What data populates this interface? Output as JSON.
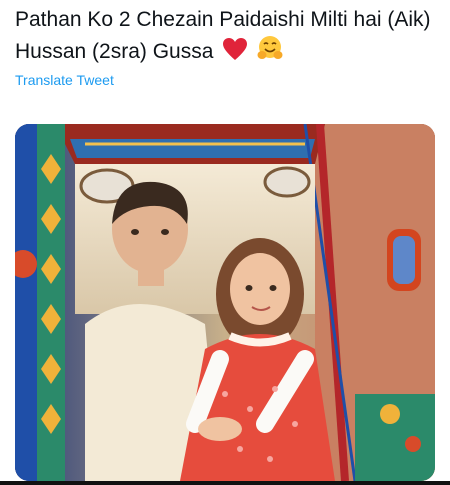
{
  "tweet": {
    "text": "Pathan Ko 2 Chezain Paidaishi Milti hai (Aik) Hussan  (2sra) Gussa",
    "emojis": [
      "red-heart",
      "smiling-face-with-open-hands"
    ],
    "translate_label": "Translate Tweet"
  },
  "photo": {
    "subject": "photo-of-two-children-in-decorated-rickshaw"
  }
}
